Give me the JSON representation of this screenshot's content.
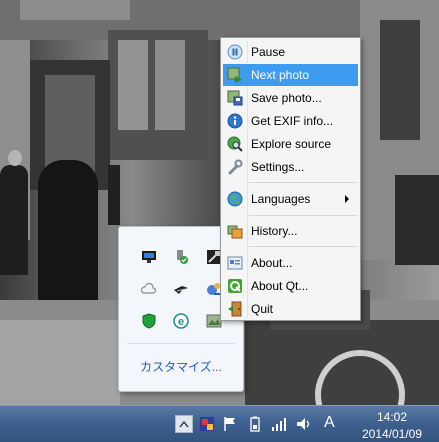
{
  "context_menu": {
    "items": [
      {
        "label": "Pause",
        "icon": "pause-icon"
      },
      {
        "label": "Next photo",
        "icon": "next-photo-icon",
        "highlighted": true
      },
      {
        "label": "Save photo...",
        "icon": "save-photo-icon"
      },
      {
        "label": "Get EXIF info...",
        "icon": "info-icon"
      },
      {
        "label": "Explore source",
        "icon": "globe-search-icon"
      },
      {
        "label": "Settings...",
        "icon": "wrench-icon"
      },
      {
        "label": "Languages",
        "icon": "globe-icon",
        "submenu": true
      },
      {
        "label": "History...",
        "icon": "history-icon"
      },
      {
        "label": "About...",
        "icon": "about-icon"
      },
      {
        "label": "About Qt...",
        "icon": "qt-icon"
      },
      {
        "label": "Quit",
        "icon": "exit-door-icon"
      }
    ],
    "highlight_color": "#3d9cf0"
  },
  "tray_popup": {
    "icons": [
      "monitor-icon",
      "usb-safely-remove-icon",
      "app-tray-icon",
      "cloud-icon",
      "bird-icon",
      "network-user-icon",
      "shield-icon",
      "e-icon",
      "photo-slideshow-icon"
    ],
    "customize_label": "カスタマイズ..."
  },
  "taskbar": {
    "ime_label": "A",
    "clock_time": "14:02",
    "clock_date": "2014/01/09",
    "icons": [
      "show-hidden-icons-arrow",
      "tray-app-icon",
      "flag-icon",
      "battery-icon",
      "signal-icon",
      "volume-icon"
    ]
  }
}
